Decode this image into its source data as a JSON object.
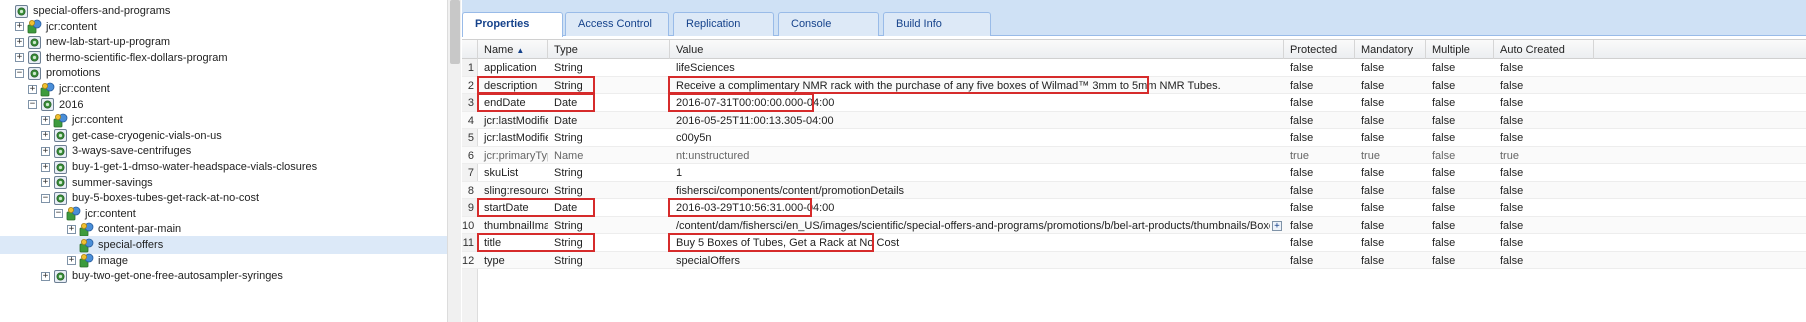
{
  "tree": {
    "nodes": [
      {
        "label": "special-offers-and-programs",
        "expander": "",
        "icon": "folder-page"
      },
      {
        "label": "jcr:content",
        "expander": "+",
        "icon": "content"
      },
      {
        "label": "new-lab-start-up-program",
        "expander": "+",
        "icon": "folder-page"
      },
      {
        "label": "thermo-scientific-flex-dollars-program",
        "expander": "+",
        "icon": "folder-page"
      },
      {
        "label": "promotions",
        "expander": "−",
        "icon": "folder-page"
      },
      {
        "label": "jcr:content",
        "expander": "+",
        "icon": "content"
      },
      {
        "label": "2016",
        "expander": "−",
        "icon": "folder-page"
      },
      {
        "label": "jcr:content",
        "expander": "+",
        "icon": "content"
      },
      {
        "label": "get-case-cryogenic-vials-on-us",
        "expander": "+",
        "icon": "folder-page"
      },
      {
        "label": "3-ways-save-centrifuges",
        "expander": "+",
        "icon": "folder-page"
      },
      {
        "label": "buy-1-get-1-dmso-water-headspace-vials-closures",
        "expander": "+",
        "icon": "folder-page"
      },
      {
        "label": "summer-savings",
        "expander": "+",
        "icon": "folder-page"
      },
      {
        "label": "buy-5-boxes-tubes-get-rack-at-no-cost",
        "expander": "−",
        "icon": "folder-page"
      },
      {
        "label": "jcr:content",
        "expander": "−",
        "icon": "content"
      },
      {
        "label": "content-par-main",
        "expander": "+",
        "icon": "content"
      },
      {
        "label": "special-offers",
        "expander": "",
        "icon": "content"
      },
      {
        "label": "image",
        "expander": "+",
        "icon": "content"
      },
      {
        "label": "buy-two-get-one-free-autosampler-syringes",
        "expander": "+",
        "icon": "folder-page"
      }
    ]
  },
  "tabs": [
    {
      "label": "Properties",
      "active": true
    },
    {
      "label": "Access Control",
      "active": false
    },
    {
      "label": "Replication",
      "active": false
    },
    {
      "label": "Console",
      "active": false
    },
    {
      "label": "Build Info",
      "active": false
    }
  ],
  "grid": {
    "columns": [
      "Name",
      "Type",
      "Value",
      "Protected",
      "Mandatory",
      "Multiple",
      "Auto Created"
    ],
    "sort_indicator": "▲",
    "rows": [
      {
        "num": "1",
        "name": "application",
        "type": "String",
        "value": "lifeSciences",
        "protected": "false",
        "mandatory": "false",
        "multiple": "false",
        "auto": "false",
        "muted": false,
        "highlight": false
      },
      {
        "num": "2",
        "name": "description",
        "type": "String",
        "value": "Receive a complimentary NMR rack with the purchase of any five boxes of Wilmad™ 3mm to 5mm NMR Tubes.",
        "protected": "false",
        "mandatory": "false",
        "multiple": "false",
        "auto": "false",
        "muted": false,
        "highlight": true
      },
      {
        "num": "3",
        "name": "endDate",
        "type": "Date",
        "value": "2016-07-31T00:00:00.000-04:00",
        "protected": "false",
        "mandatory": "false",
        "multiple": "false",
        "auto": "false",
        "muted": false,
        "highlight": true
      },
      {
        "num": "4",
        "name": "jcr:lastModified",
        "type": "Date",
        "value": "2016-05-25T11:00:13.305-04:00",
        "protected": "false",
        "mandatory": "false",
        "multiple": "false",
        "auto": "false",
        "muted": false,
        "highlight": false
      },
      {
        "num": "5",
        "name": "jcr:lastModifiedBy",
        "type": "String",
        "value": "c00y5n",
        "protected": "false",
        "mandatory": "false",
        "multiple": "false",
        "auto": "false",
        "muted": false,
        "highlight": false
      },
      {
        "num": "6",
        "name": "jcr:primaryType",
        "type": "Name",
        "value": "nt:unstructured",
        "protected": "true",
        "mandatory": "true",
        "multiple": "false",
        "auto": "true",
        "muted": true,
        "highlight": false
      },
      {
        "num": "7",
        "name": "skuList",
        "type": "String",
        "value": "1",
        "protected": "false",
        "mandatory": "false",
        "multiple": "false",
        "auto": "false",
        "muted": false,
        "highlight": false
      },
      {
        "num": "8",
        "name": "sling:resourceType",
        "type": "String",
        "value": "fishersci/components/content/promotionDetails",
        "protected": "false",
        "mandatory": "false",
        "multiple": "false",
        "auto": "false",
        "muted": false,
        "highlight": false
      },
      {
        "num": "9",
        "name": "startDate",
        "type": "Date",
        "value": "2016-03-29T10:56:31.000-04:00",
        "protected": "false",
        "mandatory": "false",
        "multiple": "false",
        "auto": "false",
        "muted": false,
        "highlight": true
      },
      {
        "num": "10",
        "name": "thumbnailImage",
        "type": "String",
        "value": "/content/dam/fishersci/en_US/images/scientific/special-offers-and-programs/promotions/b/bel-art-products/thumbnails/Boxes-of-Tubes-thum...",
        "protected": "false",
        "mandatory": "false",
        "multiple": "false",
        "auto": "false",
        "muted": false,
        "highlight": false
      },
      {
        "num": "11",
        "name": "title",
        "type": "String",
        "value": "Buy 5 Boxes of Tubes, Get a Rack at No Cost",
        "protected": "false",
        "mandatory": "false",
        "multiple": "false",
        "auto": "false",
        "muted": false,
        "highlight": true
      },
      {
        "num": "12",
        "name": "type",
        "type": "String",
        "value": "specialOffers",
        "protected": "false",
        "mandatory": "false",
        "multiple": "false",
        "auto": "false",
        "muted": false,
        "highlight": false
      }
    ],
    "expand_button_label": "+"
  },
  "colors": {
    "highlight_border": "#d62b2b",
    "tab_text": "#15428b",
    "tabbar_bg": "#cfe1f5",
    "selected_row": "#dce9f8"
  }
}
